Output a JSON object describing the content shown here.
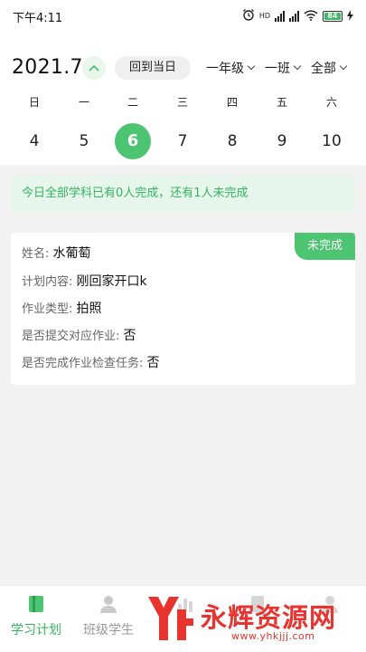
{
  "status_bar": {
    "time": "下午4:11",
    "hd_label": "HD",
    "battery": "84"
  },
  "calendar": {
    "month": "2021.7",
    "today_button": "回到当日",
    "filters": {
      "grade": "一年级",
      "class": "一班",
      "scope": "全部"
    },
    "weekdays": [
      "日",
      "一",
      "二",
      "三",
      "四",
      "五",
      "六"
    ],
    "dates": [
      "4",
      "5",
      "6",
      "7",
      "8",
      "9",
      "10"
    ],
    "selected_index": 2
  },
  "notice": "今日全部学科已有0人完成，还有1人未完成",
  "card": {
    "status": "未完成",
    "fields": [
      {
        "label": "姓名: ",
        "value": "水葡萄"
      },
      {
        "label": "计划内容: ",
        "value": "刚回家开口k"
      },
      {
        "label": "作业类型: ",
        "value": "拍照"
      },
      {
        "label": "是否提交对应作业: ",
        "value": "否"
      },
      {
        "label": "是否完成作业检查任务: ",
        "value": "否"
      }
    ]
  },
  "tabbar": {
    "tabs": [
      {
        "label": "学习计划",
        "icon": "book-icon",
        "active": true
      },
      {
        "label": "班级学生",
        "icon": "user-icon",
        "active": false
      },
      {
        "label": "",
        "icon": "chart-icon",
        "active": false
      },
      {
        "label": "",
        "icon": "doc-icon",
        "active": false
      },
      {
        "label": "",
        "icon": "person-icon",
        "active": false
      }
    ]
  },
  "watermark": {
    "text": "永辉资源网",
    "url": "www.yhkjjj.com"
  },
  "colors": {
    "accent": "#4cc472",
    "accent_text": "#35b55c",
    "notice_bg": "#e7f6ec",
    "watermark": "#e8332f"
  }
}
